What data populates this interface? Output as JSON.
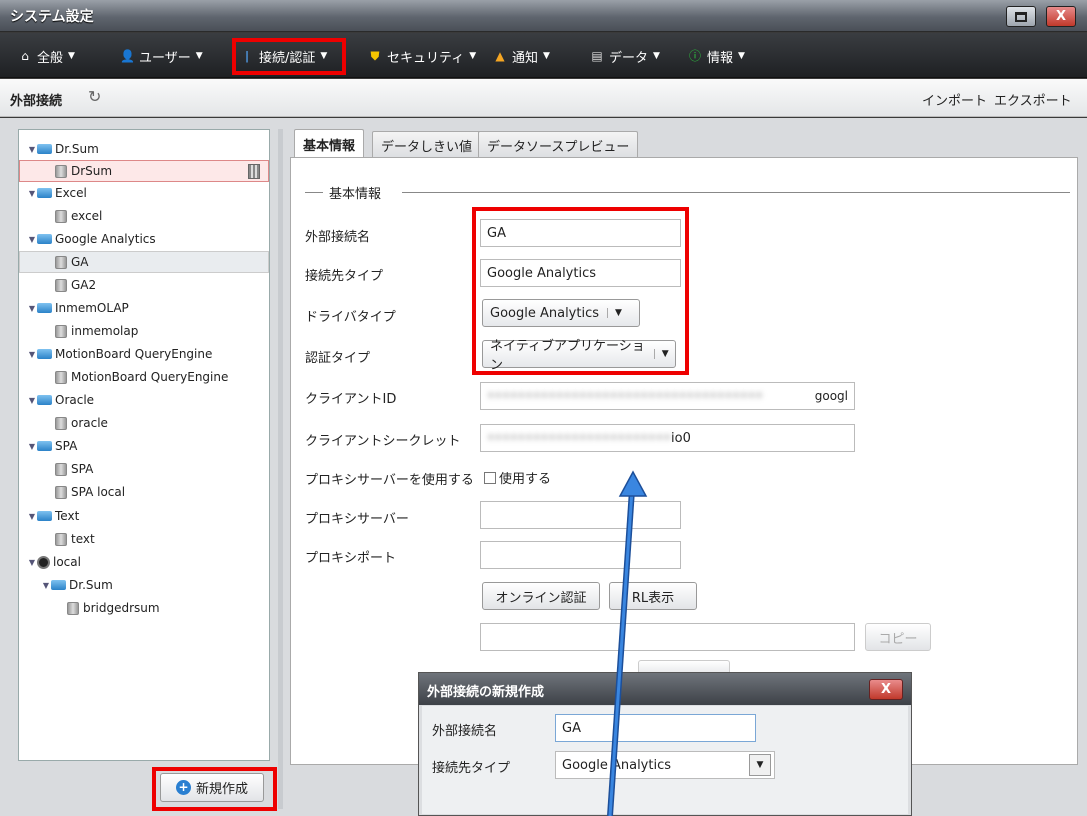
{
  "window": {
    "title": "システム設定",
    "maximize_label": "",
    "close_label": "X"
  },
  "menu": {
    "items": [
      {
        "label": "全般",
        "icon": "home-icon"
      },
      {
        "label": "ユーザー",
        "icon": "user-icon"
      },
      {
        "label": "接続/認証",
        "icon": "plug-icon"
      },
      {
        "label": "セキュリティ",
        "icon": "shield-icon"
      },
      {
        "label": "通知",
        "icon": "bell-icon"
      },
      {
        "label": "データ",
        "icon": "data-icon"
      },
      {
        "label": "情報",
        "icon": "info-icon"
      }
    ]
  },
  "subheader": {
    "title": "外部接続",
    "import_label": "インポート",
    "export_label": "エクスポート"
  },
  "tree": {
    "items": [
      {
        "label": "Dr.Sum",
        "type": "folder"
      },
      {
        "label": "DrSum",
        "type": "db"
      },
      {
        "label": "Excel",
        "type": "folder"
      },
      {
        "label": "excel",
        "type": "db"
      },
      {
        "label": "Google Analytics",
        "type": "folder"
      },
      {
        "label": "GA",
        "type": "db"
      },
      {
        "label": "GA2",
        "type": "db"
      },
      {
        "label": "InmemOLAP",
        "type": "folder"
      },
      {
        "label": "inmemolap",
        "type": "db"
      },
      {
        "label": "MotionBoard QueryEngine",
        "type": "folder"
      },
      {
        "label": "MotionBoard QueryEngine",
        "type": "db"
      },
      {
        "label": "Oracle",
        "type": "folder"
      },
      {
        "label": "oracle",
        "type": "db"
      },
      {
        "label": "SPA",
        "type": "folder"
      },
      {
        "label": "SPA",
        "type": "db"
      },
      {
        "label": "SPA local",
        "type": "db"
      },
      {
        "label": "Text",
        "type": "folder"
      },
      {
        "label": "text",
        "type": "db"
      },
      {
        "label": "local",
        "type": "globe"
      },
      {
        "label": "Dr.Sum",
        "type": "folder"
      },
      {
        "label": "bridgedrsum",
        "type": "db"
      }
    ],
    "new_button_label": "新規作成"
  },
  "tabs": [
    "基本情報",
    "データしきい値",
    "データソースプレビュー"
  ],
  "form": {
    "section_title": "基本情報",
    "connection_name_label": "外部接続名",
    "connection_name_value": "GA",
    "target_type_label": "接続先タイプ",
    "target_type_value": "Google Analytics",
    "driver_type_label": "ドライバタイプ",
    "driver_type_value": "Google Analytics",
    "auth_type_label": "認証タイプ",
    "auth_type_value": "ネイティブアプリケーション",
    "client_id_label": "クライアントID",
    "client_id_suffix": "googl",
    "client_secret_label": "クライアントシークレット",
    "client_secret_suffix": "io0",
    "use_proxy_label": "プロキシサーバーを使用する",
    "use_proxy_checkbox_label": "使用する",
    "proxy_server_label": "プロキシサーバー",
    "proxy_port_label": "プロキシポート",
    "online_auth_label": "オンライン認証",
    "url_display_label": "RL表示",
    "copy_label": "コピー"
  },
  "modal": {
    "title": "外部接続の新規作成",
    "close_label": "X",
    "connection_name_label": "外部接続名",
    "connection_name_value": "GA",
    "target_type_label": "接続先タイプ",
    "target_type_value": "Google Analytics"
  },
  "colors": {
    "highlight_red": "#e00000",
    "arrow_blue": "#2a6fd6"
  }
}
